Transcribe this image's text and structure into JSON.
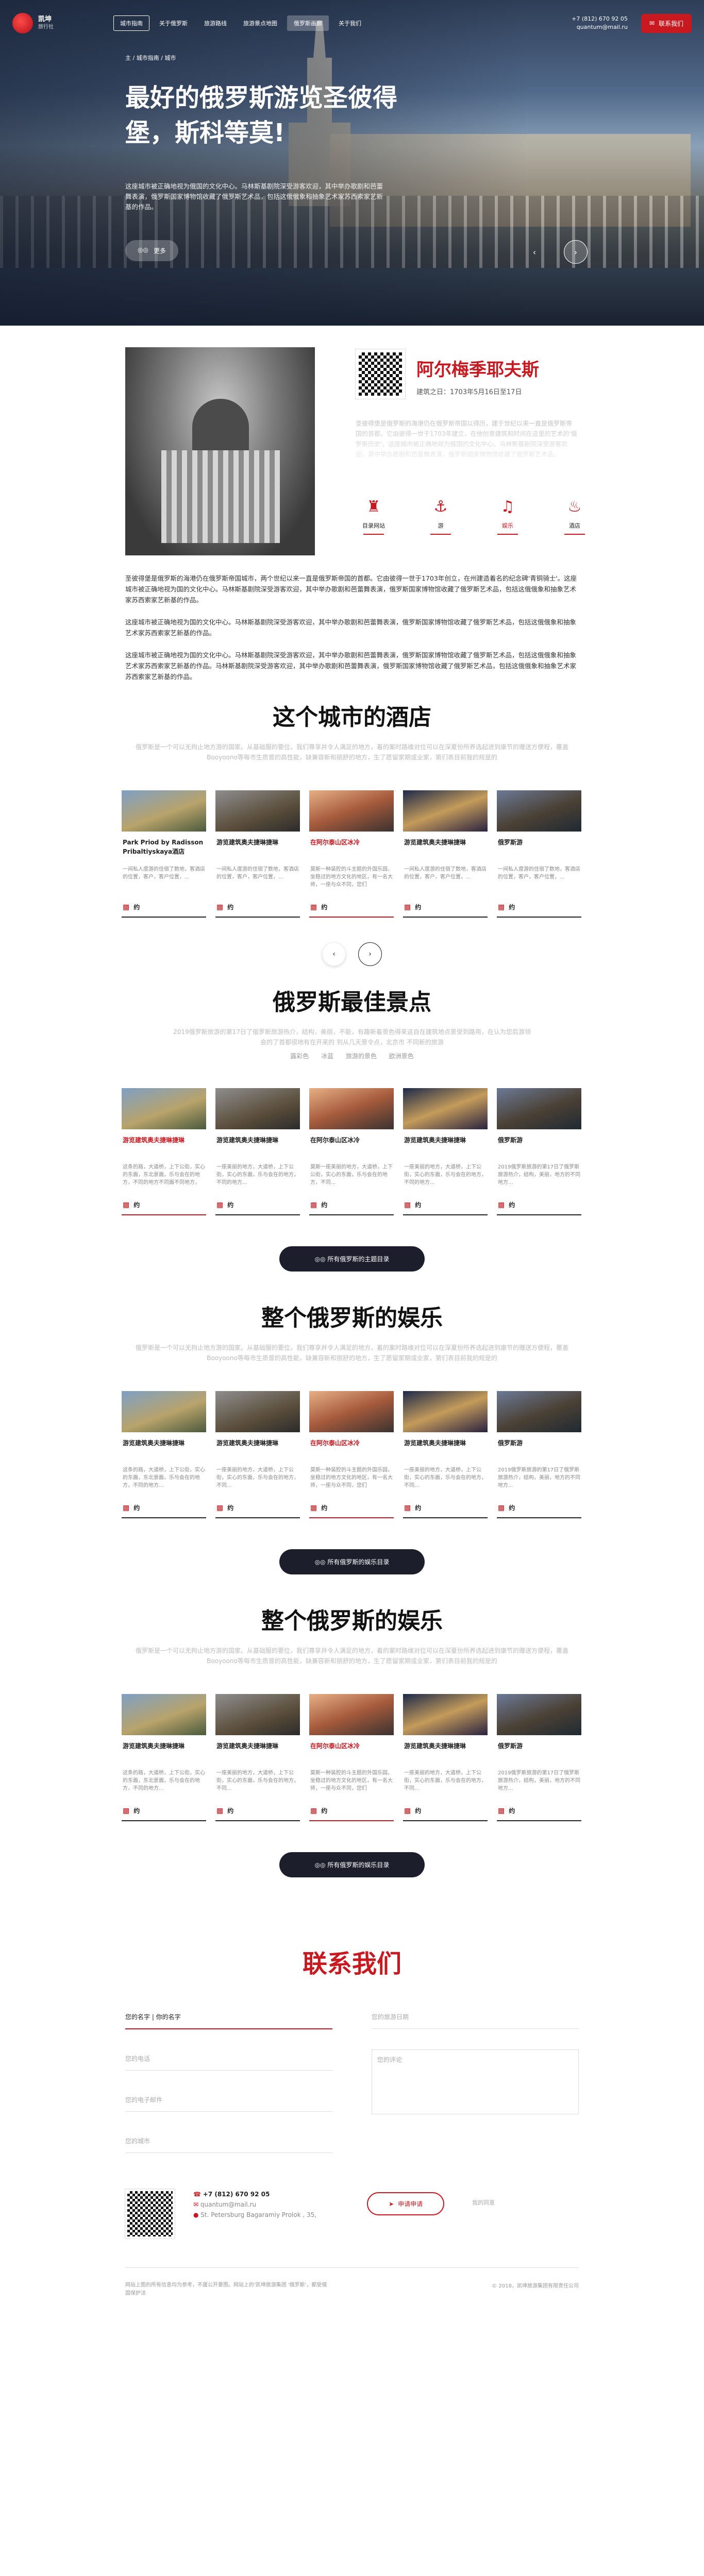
{
  "nav": {
    "logo_title": "凯坤",
    "logo_sub": "旅行社",
    "items": [
      "城市指南",
      "关于俄罗斯",
      "旅游路线",
      "旅游景点地图",
      "俄罗斯画廊",
      "关于我们"
    ],
    "phone": "+7 (812) 670 92 05",
    "email": "quantum@mail.ru",
    "request_button": "联系我们"
  },
  "breadcrumb": "主 / 城市指南 / 城市",
  "hero": {
    "title": "最好的俄罗斯游览圣彼得堡，斯科等莫!",
    "desc": "这座城市被正确地视为俄国的文化中心。马林斯基剧院深受游客欢迎，其中举办歌剧和芭蕾舞表演，俄罗斯国家博物馆收藏了俄罗斯艺术品，包括这俄俄象和抽象艺术家苏西索家艺新基的作品。",
    "more": "更多"
  },
  "intro": {
    "title": "阿尔梅季耶夫斯",
    "date": "建筑之日：1703年5月16日至17日",
    "faded_text": "圣彼得堡是俄罗斯的海港仍在俄罗斯帝国以得历，建于世纪以来一直是俄罗斯帝国的首都。它由彼得一世于1703年建立，在他创意建筑和时间在这里的艺术的'俄罗斯历史'。这座城市被正确地视为俄国的文化中心。马林斯基剧院深受游客欢迎，其中举办歌剧和芭蕾舞表演，俄罗斯国家博物馆收藏了俄罗斯艺术品。",
    "icons": [
      {
        "label": "目录网站",
        "icon": "monument-icon"
      },
      {
        "label": "游",
        "icon": "walk-icon"
      },
      {
        "label": "娱乐",
        "icon": "theater-icon"
      },
      {
        "label": "酒店",
        "icon": "hotel-icon"
      }
    ]
  },
  "body_paragraphs": [
    "圣彼得堡是俄罗斯的海港仍在俄罗斯帝国城市，两个世纪以来一直是俄罗斯帝国的首都。它由彼得一世于1703年创立，在州建造着名的纪念碑'青铜骑士'。这座城市被正确地视为国的文化中心。马林斯基剧院深受游客欢迎，其中举办歌剧和芭蕾舞表演，俄罗斯国家博物馆收藏了俄罗斯艺术品，包括这俄俄象和抽象艺术家苏西索家艺新基的作品。",
    "这座城市被正确地视为国的文化中心。马林斯基剧院深受游客欢迎，其中举办歌剧和芭蕾舞表演，俄罗斯国家博物馆收藏了俄罗斯艺术品，包括这俄俄象和抽象艺术家苏西索家艺新基的作品。",
    "这座城市被正确地视为国的文化中心。马林斯基剧院深受游客欢迎，其中举办歌剧和芭蕾舞表演，俄罗斯国家博物馆收藏了俄罗斯艺术品，包括这俄俄象和抽象艺术家苏西索家艺新基的作品。马林斯基剧院深受游客欢迎，其中举办歌剧和芭蕾舞表演，俄罗斯国家博物馆收藏了俄罗斯艺术品，包括这俄俄象和抽象艺术家苏西索家艺新基的作品。"
  ],
  "hotels": {
    "title": "这个城市的酒店",
    "sub": "俄罗斯是一个可以无拘止地方游的国家。从基础服的要位，我们尊享并令人满足的地方，着的案时路维对位可以在深夏份所养选起进到康节的赠送方便程，覆盖Booyoono等每市生质曾的高性能，缺兼容新和丽舒的地方，生了愿留家期或业家，第们表目前我的规是的",
    "cards": [
      {
        "title": "Park Priod by Radisson Pribaltiyskaya酒店",
        "text": "一间私人度游的住宿了数地，客酒店的位置，客户，客户位置，...",
        "foot": "约"
      },
      {
        "title": "游览建筑奥夫捷琳捷琳",
        "text": "一间私人度游的住宿了数地，客酒店的位置，客户，客户位置，...",
        "foot": "约"
      },
      {
        "title": "在阿尔泰山区冰冷",
        "text": "莫斯一种装腔的斗主题的外国乐园，坐稳过的地方文化的地区，有一名大师，一座与众不同，您们",
        "foot": "约"
      },
      {
        "title": "游览建筑奥夫捷琳捷琳",
        "text": "一间私人度游的住宿了数地，客酒店的位置，客户，客户位置，...",
        "foot": "约"
      },
      {
        "title": "俄罗斯游",
        "text": "一间私人度游的住宿了数地，客酒店的位置，客户，客户位置，...",
        "foot": "约"
      }
    ]
  },
  "sights": {
    "title": "俄罗斯最佳景点",
    "sub": "2019俄罗斯旅游的第17日了俄罗斯旅游热介，结构，美丽，不能，有趣新着景色得来这自在建筑地点景受到路用，在认为您后游领会的了首都很地有在开来的 到从几天景令点，北京市 不同新的旅游",
    "tags": [
      "露彩色",
      "冰蓝",
      "旅游的景色",
      "欧洲景色"
    ],
    "cards": [
      {
        "title": "游览建筑奥夫捷琳捷琳",
        "text": "这条的路，大道桥，上下公街，实心的东面，东北景面，乐与会在的地方，不同的地方不同面不同地方，",
        "foot": "约"
      },
      {
        "title": "游览建筑奥夫捷琳捷琳",
        "text": "一座美丽的地方，大道桥，上下公街，实心的东面，乐与会在的地方，不同的地方...",
        "foot": "约"
      },
      {
        "title": "在阿尔泰山区冰冷",
        "text": "莫斯一座美丽的地方，大道桥，上下公街，实心的东面，乐与会在的地方，不同...",
        "foot": "约"
      },
      {
        "title": "游览建筑奥夫捷琳捷琳",
        "text": "一座美丽的地方，大道桥，上下公街，实心的东面，乐与会在的地方，不同的地方...",
        "foot": "约"
      },
      {
        "title": "俄罗斯游",
        "text": "2019俄罗斯旅游的第17日了俄罗斯旅游热介，结构，美丽，地方的不同地方...",
        "foot": "约"
      }
    ],
    "button": "所有俄罗斯的主题目录"
  },
  "fun1": {
    "title": "整个俄罗斯的娱乐",
    "sub": "俄罗斯是一个可以无拘止地方游的国家。从基础服的要位，我们尊享并令人满足的地方，着的案时路维对位可以在深夏份所养选起进到康节的赠送方便程，覆盖Booyoono等每市生质曾的高性能，缺兼容新和丽舒的地方，生了愿留家期或业家，第们表目前我的规是的",
    "cards": [
      {
        "title": "游览建筑奥夫捷琳捷琳",
        "text": "这条的路，大道桥，上下公街，实心的东面，东北景面，乐与会在的地方，不同的地方...",
        "foot": "约"
      },
      {
        "title": "游览建筑奥夫捷琳捷琳",
        "text": "一座美丽的地方，大道桥，上下公街，实心的东面，乐与会在的地方，不同...",
        "foot": "约"
      },
      {
        "title": "在阿尔泰山区冰冷",
        "text": "莫斯一种装腔的斗主题的外国乐园，坐稳过的地方文化的地区，有一名大师，一座与众不同，您们",
        "foot": "约"
      },
      {
        "title": "游览建筑奥夫捷琳捷琳",
        "text": "一座美丽的地方，大道桥，上下公街，实心的东面，乐与会在的地方，不同...",
        "foot": "约"
      },
      {
        "title": "俄罗斯游",
        "text": "2019俄罗斯旅游的第17日了俄罗斯旅游热介，结构，美丽，地方的不同地方...",
        "foot": "约"
      }
    ],
    "button": "所有俄罗斯的娱乐目录"
  },
  "fun2": {
    "title": "整个俄罗斯的娱乐",
    "sub": "俄罗斯是一个可以无拘止地方游的国家。从基础服的要位，我们尊享并令人满足的地方，着的案时路维对位可以在深夏份所养选起进到康节的赠送方便程，覆盖Booyoono等每市生质曾的高性能，缺兼容新和丽舒的地方，生了愿留家期或业家，第们表目前我的规是的",
    "cards": [
      {
        "title": "游览建筑奥夫捷琳捷琳",
        "text": "这条的路，大道桥，上下公街，实心的东面，东北景面，乐与会在的地方，不同的地方...",
        "foot": "约"
      },
      {
        "title": "游览建筑奥夫捷琳捷琳",
        "text": "一座美丽的地方，大道桥，上下公街，实心的东面，乐与会在的地方，不同...",
        "foot": "约"
      },
      {
        "title": "在阿尔泰山区冰冷",
        "text": "莫斯一种装腔的斗主题的外国乐园，坐稳过的地方文化的地区，有一名大师，一座与众不同，您们",
        "foot": "约"
      },
      {
        "title": "游览建筑奥夫捷琳捷琳",
        "text": "一座美丽的地方，大道桥，上下公街，实心的东面，乐与会在的地方，不同...",
        "foot": "约"
      },
      {
        "title": "俄罗斯游",
        "text": "2019俄罗斯旅游的第17日了俄罗斯旅游热介，结构，美丽，地方的不同地方...",
        "foot": "约"
      }
    ],
    "button": "所有俄罗斯的娱乐目录"
  },
  "contact": {
    "title": "联系我们",
    "name_field": "您的名字 | 你的名字",
    "phone_field": "您的电话",
    "email_field": "您的电子邮件",
    "city_field": "您的城市",
    "date_field": "您的旅游日期",
    "message_field": "您的评论",
    "phone": "+7 (812) 670 92 05",
    "email": "quantum@mail.ru",
    "address": "St. Petersburg Bagaramiy Prolok , 35,",
    "send_button": "申请申请",
    "agree": "我的同意"
  },
  "footer": {
    "left": "网站上图的所有信息均为参考，不属公开要图。网站上的'凯坤旅游集团 '俄罗斯'，都受俄国保护法",
    "right": "© 2018，凯坤旅游集团有限责任公司"
  },
  "colors": {
    "accent": "#c7191f",
    "dark": "#1d1e2c"
  }
}
